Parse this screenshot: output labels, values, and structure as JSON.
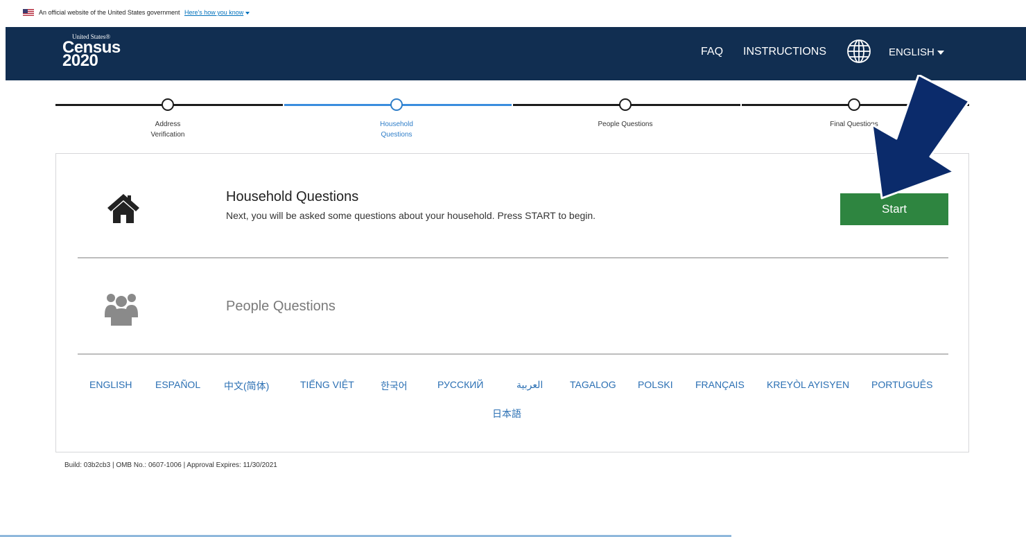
{
  "gov_banner": {
    "text": "An official website of the United States government",
    "link": "Here's how you know"
  },
  "header": {
    "logo": {
      "line1": "United States®",
      "line2": "Census",
      "line3": "2020"
    },
    "nav": {
      "faq": "FAQ",
      "instructions": "INSTRUCTIONS",
      "language": "ENGLISH"
    },
    "icons": {
      "globe": "globe-icon"
    }
  },
  "progress": {
    "steps": [
      {
        "label1": "Address",
        "label2": "Verification",
        "state": "complete"
      },
      {
        "label1": "Household",
        "label2": "Questions",
        "state": "current"
      },
      {
        "label1": "People Questions",
        "label2": "",
        "state": "upcoming"
      },
      {
        "label1": "Final Questions",
        "label2": "",
        "state": "upcoming"
      }
    ]
  },
  "sections": {
    "household": {
      "title": "Household Questions",
      "description": "Next, you will be asked some questions about your household. Press START to begin.",
      "button": "Start",
      "icon": "house-icon"
    },
    "people": {
      "title": "People Questions",
      "icon": "people-icon"
    }
  },
  "languages": [
    "ENGLISH",
    "ESPAÑOL",
    "中文(简体)",
    "TIẾNG VIỆT",
    "한국어",
    "РУССКИЙ",
    "العربية",
    "TAGALOG",
    "POLSKI",
    "FRANÇAIS",
    "KREYÒL AYISYEN",
    "PORTUGUÊS",
    "日本語"
  ],
  "footer": {
    "text": "Build: 03b2cb3 | OMB No.: 0607-1006 | Approval Expires: 11/30/2021"
  },
  "colors": {
    "header_bg": "#112e51",
    "start_button": "#2e8540",
    "link": "#2a6fb3",
    "active_step": "#3a8dde",
    "annotation_arrow": "#0b2b6b"
  }
}
